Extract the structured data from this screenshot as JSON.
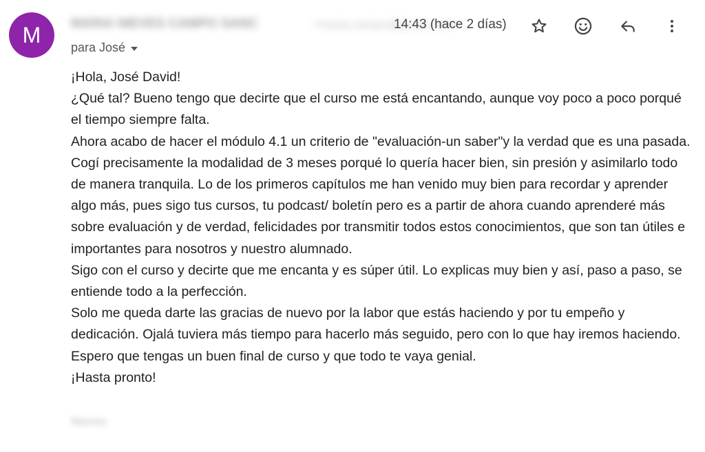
{
  "avatar": {
    "letter": "M",
    "color": "#8e24aa"
  },
  "sender": {
    "name": "MARIA NIEVES CAMPO SANC",
    "email": "<maria.campo@gmail.com>"
  },
  "timestamp": "14:43 (hace 2 días)",
  "toolbar": {
    "star_icon": "star-icon",
    "emoji_icon": "emoji-icon",
    "reply_icon": "reply-icon",
    "more_icon": "more-vert-icon"
  },
  "recipient": {
    "label": "para José"
  },
  "message": {
    "paragraphs": [
      "¡Hola, José David!",
      "¿Qué tal? Bueno tengo que decirte que el curso me está encantando, aunque voy poco a poco porqué el tiempo siempre falta.",
      "Ahora acabo de hacer el módulo 4.1 un criterio de \"evaluación-un saber\"y la verdad que es una pasada. Cogí precisamente la modalidad de 3 meses porqué lo quería hacer bien, sin presión y asimilarlo todo de manera tranquila. Lo de los primeros capítulos me han venido muy bien para recordar y aprender algo más, pues sigo tus cursos, tu podcast/ boletín pero es a partir de ahora cuando  aprenderé más sobre evaluación y de verdad, felicidades por transmitir todos estos conocimientos, que son tan útiles e importantes para nosotros y nuestro alumnado.",
      "Sigo con el curso y decirte que me encanta y es súper útil. Lo explicas muy bien y así, paso a paso, se entiende todo a la perfección.",
      "Solo me queda darte las gracias de nuevo por la labor que estás haciendo y por tu empeño y dedicación. Ojalá tuviera más tiempo para hacerlo más seguido, pero con lo que hay iremos haciendo.",
      "Espero que tengas un buen final de curso y que todo te vaya genial.",
      "¡Hasta pronto!"
    ],
    "signature": "Nieves"
  }
}
